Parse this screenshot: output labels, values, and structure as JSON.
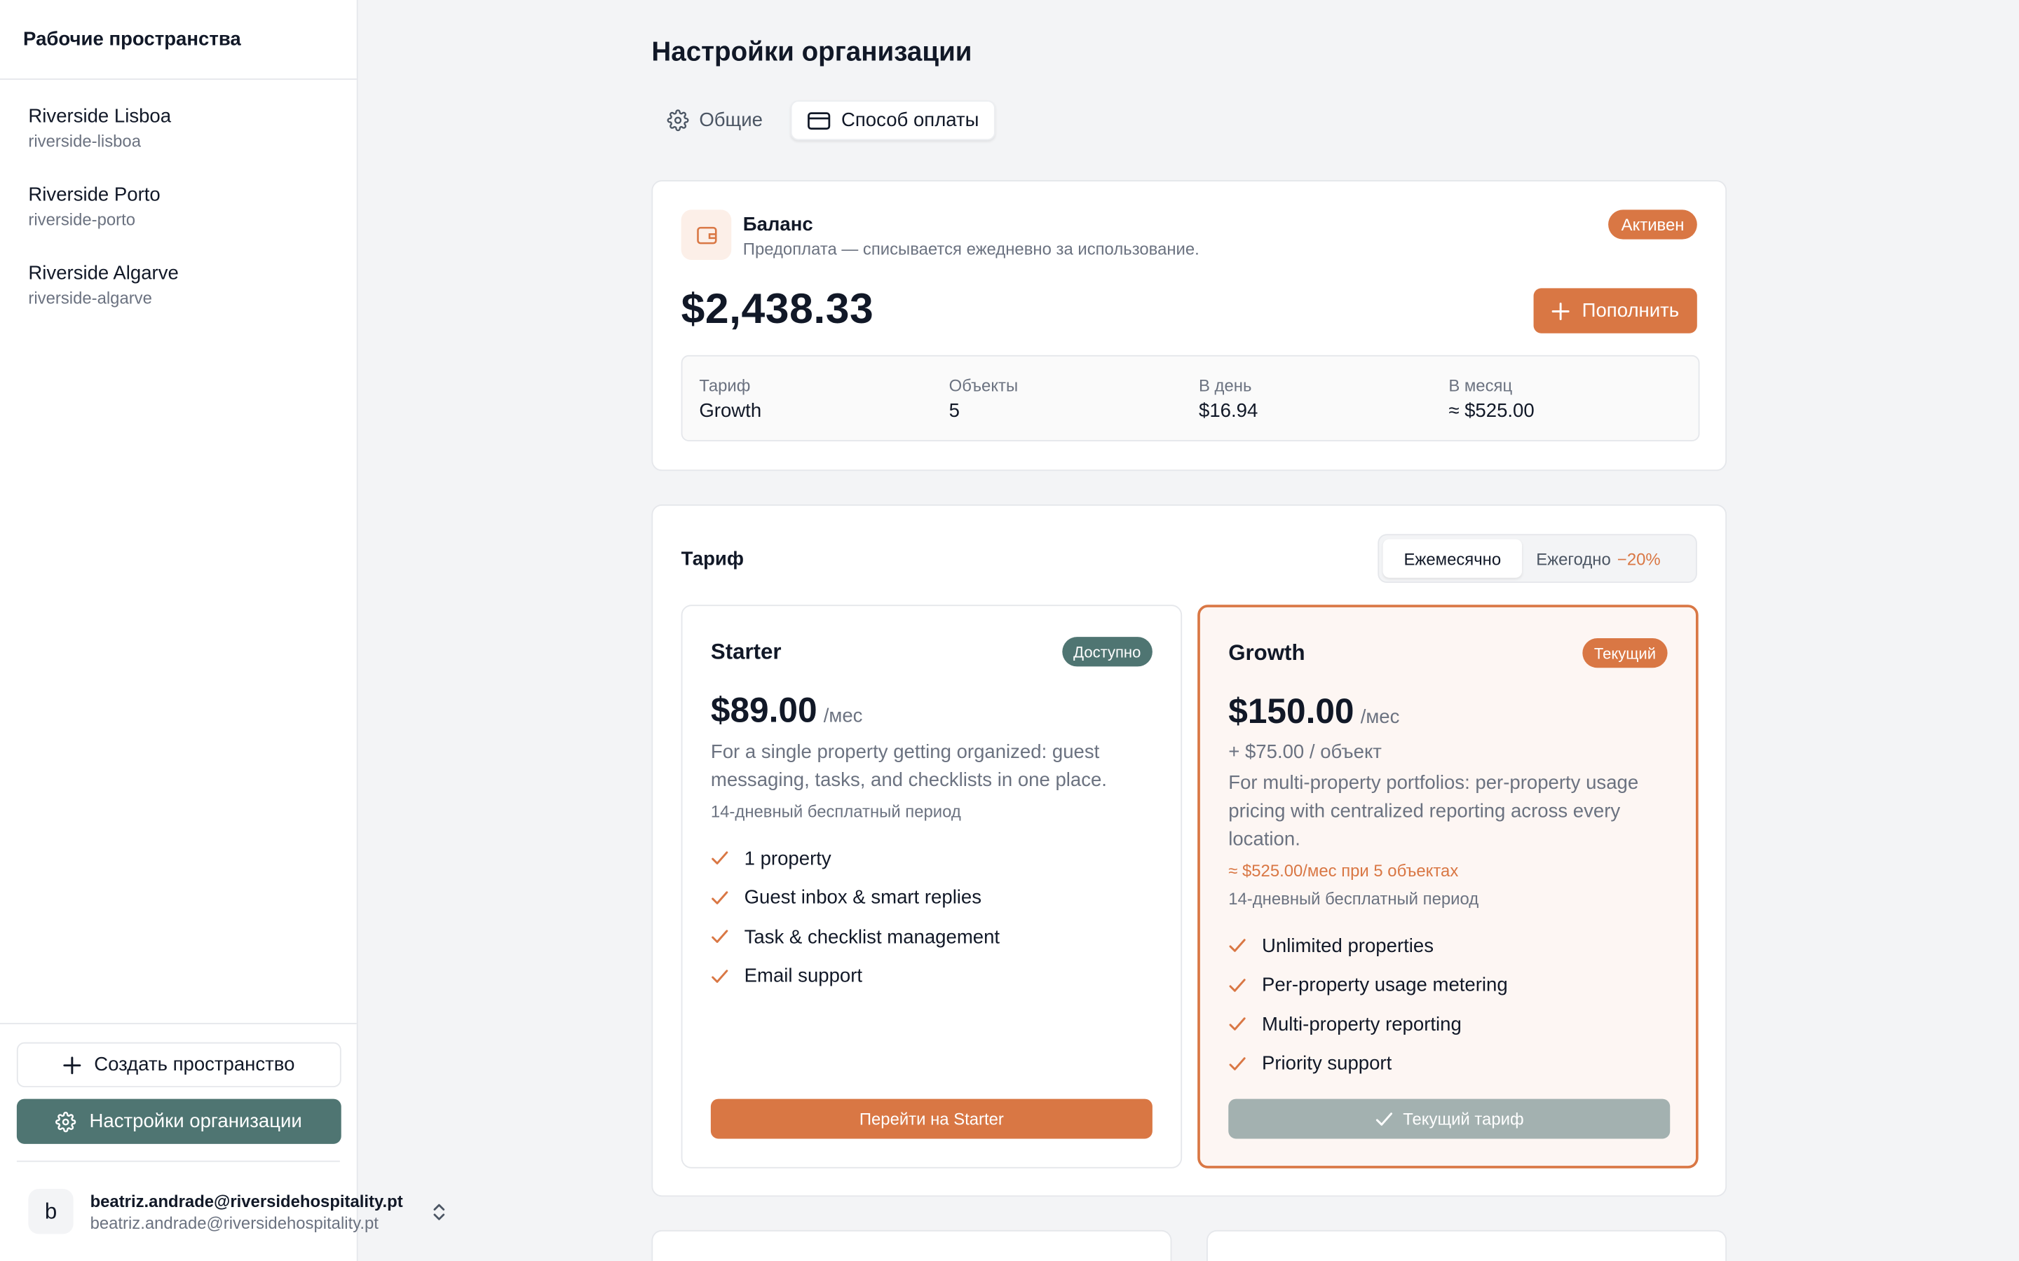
{
  "sidebar": {
    "title": "Рабочие пространства",
    "workspaces": [
      {
        "name": "Riverside Lisboa",
        "slug": "riverside-lisboa"
      },
      {
        "name": "Riverside Porto",
        "slug": "riverside-porto"
      },
      {
        "name": "Riverside Algarve",
        "slug": "riverside-algarve"
      }
    ],
    "create_label": "Создать пространство",
    "org_settings_label": "Настройки организации",
    "user": {
      "initial": "b",
      "email": "beatriz.andrade@riversidehospitality.pt",
      "email_secondary": "beatriz.andrade@riversidehospitality.pt"
    }
  },
  "page": {
    "title": "Настройки организации",
    "tabs": [
      {
        "label": "Общие",
        "icon": "gear-icon"
      },
      {
        "label": "Способ оплаты",
        "icon": "credit-card-icon"
      }
    ]
  },
  "balance": {
    "title": "Баланс",
    "subtitle": "Предоплата — списывается ежедневно за использование.",
    "status": "Активен",
    "amount": "$2,438.33",
    "topup_label": "Пополнить",
    "stats": [
      {
        "label": "Тариф",
        "value": "Growth"
      },
      {
        "label": "Объекты",
        "value": "5"
      },
      {
        "label": "В день",
        "value": "$16.94"
      },
      {
        "label": "В месяц",
        "value": "≈ $525.00"
      }
    ]
  },
  "plans": {
    "title": "Тариф",
    "billing": {
      "monthly": "Ежемесячно",
      "yearly": "Ежегодно",
      "discount": "−20%"
    },
    "tiers": [
      {
        "name": "Starter",
        "badge": "Доступно",
        "price": "$89.00",
        "per": "/мес",
        "description": "For a single property getting organized: guest messaging, tasks, and checklists in one place.",
        "trial": "14-дневный бесплатный период",
        "features": [
          "1 property",
          "Guest inbox & smart replies",
          "Task & checklist management",
          "Email support"
        ],
        "cta": "Перейти на Starter"
      },
      {
        "name": "Growth",
        "badge": "Текущий",
        "price": "$150.00",
        "per": "/мес",
        "extra": "+ $75.00 / объект",
        "description": "For multi-property portfolios: per-property usage pricing with centralized reporting across every location.",
        "estimate": "≈ $525.00/мес при 5 объектах",
        "trial": "14-дневный бесплатный период",
        "features": [
          "Unlimited properties",
          "Per-property usage metering",
          "Multi-property reporting",
          "Priority support"
        ],
        "cta": "Текущий тариф"
      }
    ]
  },
  "colors": {
    "accent": "#d97744",
    "sidebar_primary": "#4f7572",
    "disabled_button": "#a3b1b0"
  }
}
